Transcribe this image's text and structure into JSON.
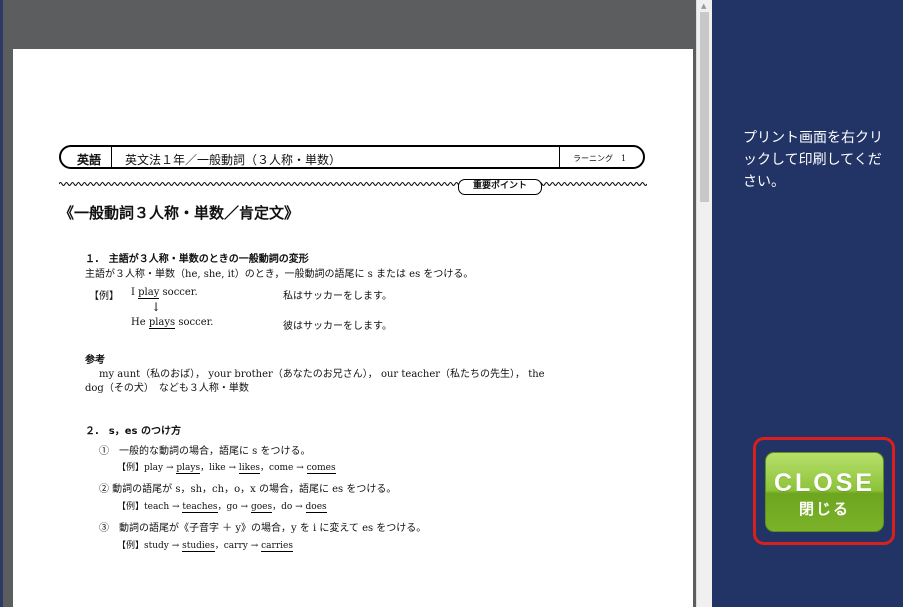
{
  "document": {
    "header": {
      "subject": "英語",
      "title": "英文法１年／一般動詞（３人称・単数）",
      "code": "ラーニング　1"
    },
    "point_badge": "重要ポイント",
    "title": "《一般動詞３人称・単数／肯定文》",
    "section1": {
      "heading": "１.　主語が３人称・単数のときの一般動詞の変形",
      "body": "主語が３人称・単数（he, she, it）のとき，一般動詞の語尾に s または es をつける。",
      "example_label": "【例】",
      "ex1_pre": "I ",
      "ex1_verb": "play",
      "ex1_post": " soccer.",
      "ex1_ja": "私はサッカーをします。",
      "arrow": "↓",
      "ex2_pre": "He ",
      "ex2_verb": "plays",
      "ex2_post": " soccer.",
      "ex2_ja": "彼はサッカーをします。"
    },
    "reference": {
      "heading": "参考",
      "line1": "my aunt（私のおば）， your brother（あなたのお兄さん）， our teacher（私たちの先生）， the",
      "line2": "dog（その犬）　なども３人称・単数"
    },
    "section2": {
      "heading": "２.　s，es のつけ方",
      "rule1": "①　一般的な動詞の場合，語尾に s をつける。",
      "rule1_pre": "【例】play → ",
      "rule1_a": "plays",
      "rule1_mid": "，like → ",
      "rule1_b": "likes",
      "rule1_mid2": "，come → ",
      "rule1_c": "comes",
      "rule2": "② 動詞の語尾が s，sh，ch，o，x の場合，語尾に es をつける。",
      "rule2_pre": "【例】teach → ",
      "rule2_a": "teaches",
      "rule2_mid": "，go → ",
      "rule2_b": "goes",
      "rule2_mid2": "，do → ",
      "rule2_c": "does",
      "rule3": "③　動詞の語尾が《子音字 ＋ y》の場合，y を i に変えて es をつける。",
      "rule3_pre": "【例】study → ",
      "rule3_a": "studies",
      "rule3_mid": "，carry → ",
      "rule3_b": "carries"
    }
  },
  "side_panel": {
    "instruction": "プリント画面を右クリックして印刷してください。"
  },
  "close_button": {
    "label_en": "CLOSE",
    "label_ja": "閉じる"
  },
  "colors": {
    "side_bg": "#223365",
    "viewer_bg": "#5b5d5f",
    "close_border": "#d8201f",
    "close_green": "#8cc33a"
  }
}
